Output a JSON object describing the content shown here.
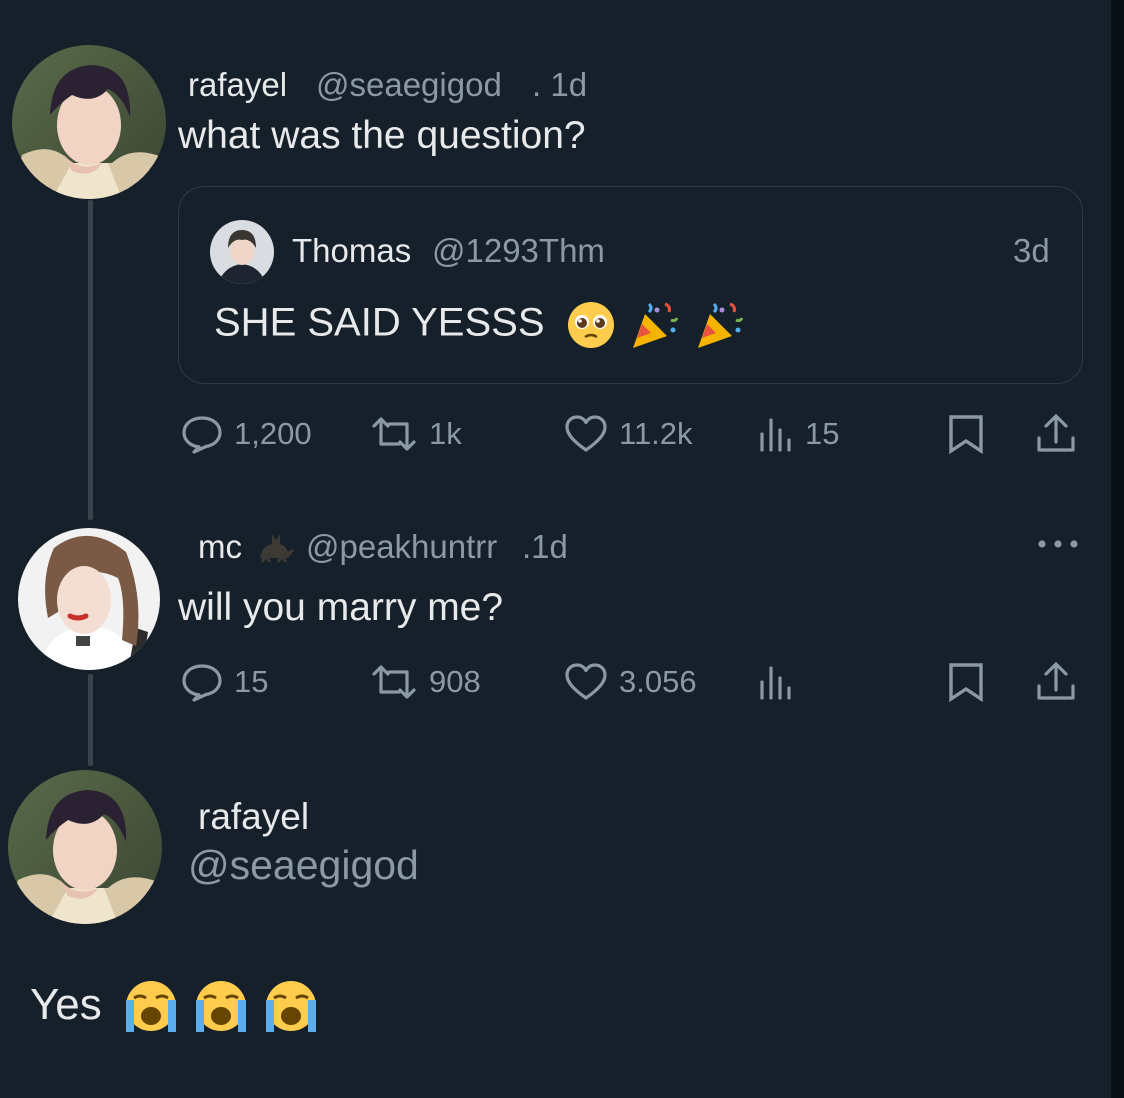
{
  "tweets": [
    {
      "name": "rafayel",
      "handle": "@seaegigod",
      "time": ". 1d",
      "text": "what was the question?",
      "quote": {
        "name": "Thomas",
        "handle": "@1293Thm",
        "time": "3d",
        "text": "SHE SAID YESSS",
        "emojis": [
          "pleading-face-emoji",
          "party-popper-emoji",
          "party-popper-emoji"
        ]
      },
      "actions": {
        "replies": "1,200",
        "retweets": "1k",
        "likes": "11.2k",
        "views": "15"
      }
    },
    {
      "name": "mc",
      "name_emoji": "cat-emoji",
      "handle": "@peakhuntrr",
      "time": ".1d",
      "text": "will you marry me?",
      "actions": {
        "replies": "15",
        "retweets": "908",
        "likes": "3.056",
        "views": ""
      }
    },
    {
      "name": "rafayel",
      "handle": "@seaegigod",
      "text": "Yes",
      "emojis": [
        "loudly-crying-face-emoji",
        "loudly-crying-face-emoji",
        "loudly-crying-face-emoji"
      ]
    }
  ],
  "icons": {
    "reply": "speech-bubble-icon",
    "retweet": "retweet-icon",
    "like": "heart-icon",
    "views": "bar-chart-icon",
    "bookmark": "bookmark-icon",
    "share": "share-icon",
    "more": "more-dots-icon"
  },
  "colors": {
    "background": "#15202b",
    "text": "#e7e9ea",
    "secondary_text": "#8b98a5",
    "border": "#2f3a44",
    "thread_line": "#38444d"
  }
}
